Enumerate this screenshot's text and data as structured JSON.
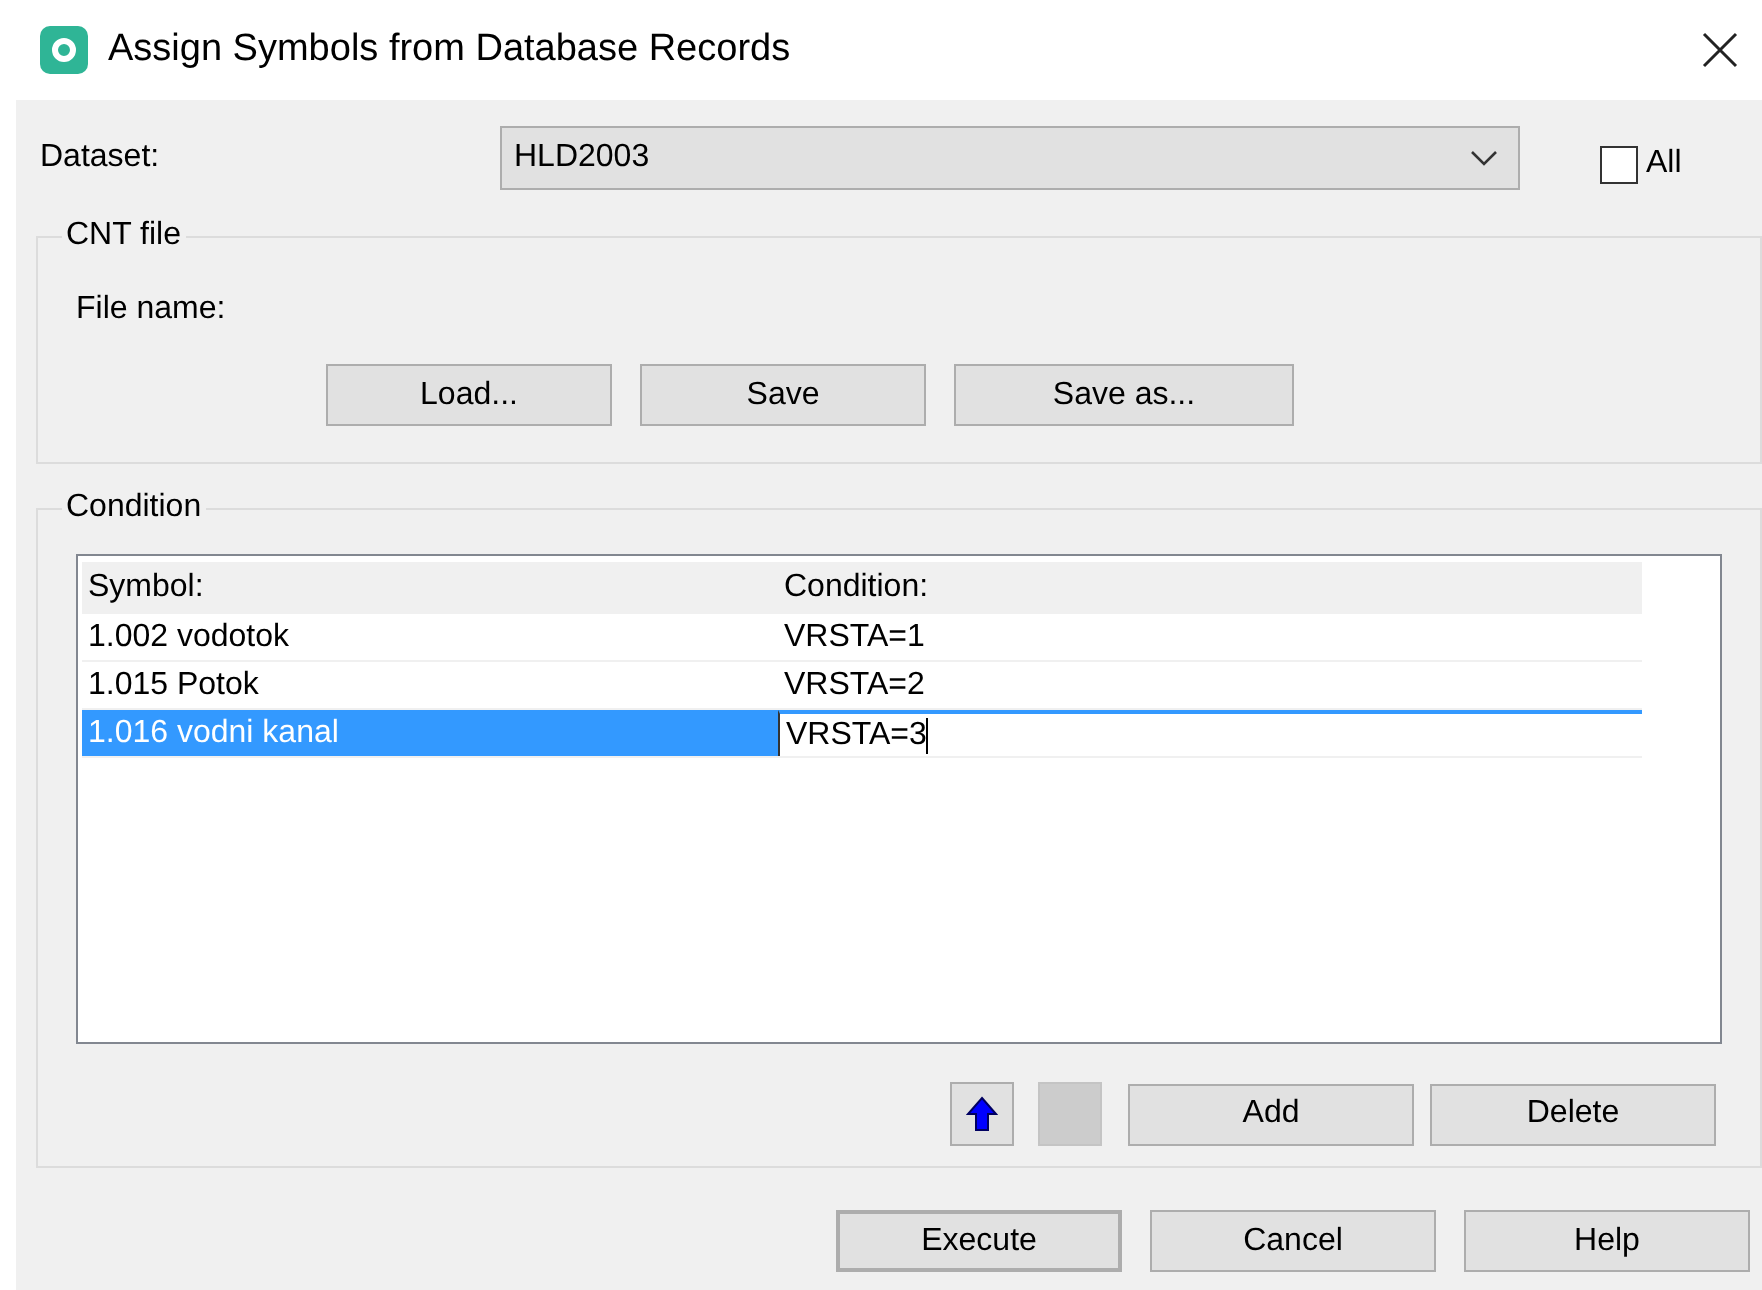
{
  "window": {
    "title": "Assign Symbols from Database Records"
  },
  "dataset": {
    "label": "Dataset:",
    "value": "HLD2003"
  },
  "all_checkbox": {
    "label": "All",
    "checked": false
  },
  "cnt_file": {
    "title": "CNT file",
    "file_name_label": "File name:",
    "buttons": [
      "Load...",
      "Save",
      "Save as..."
    ]
  },
  "condition": {
    "title": "Condition",
    "columns": [
      "Symbol:",
      "Condition:"
    ],
    "rows": [
      {
        "symbol": "1.002 vodotok",
        "condition": "VRSTA=1",
        "selected": false,
        "editing": false
      },
      {
        "symbol": "1.015 Potok",
        "condition": "VRSTA=2",
        "selected": false,
        "editing": false
      },
      {
        "symbol": "1.016 vodni kanal",
        "condition": "VRSTA=3",
        "selected": true,
        "editing": true
      }
    ],
    "buttons": [
      "Add",
      "Delete"
    ]
  },
  "footer_buttons": [
    {
      "label": "Execute",
      "default": true
    },
    {
      "label": "Cancel",
      "default": false
    },
    {
      "label": "Help",
      "default": false
    }
  ]
}
